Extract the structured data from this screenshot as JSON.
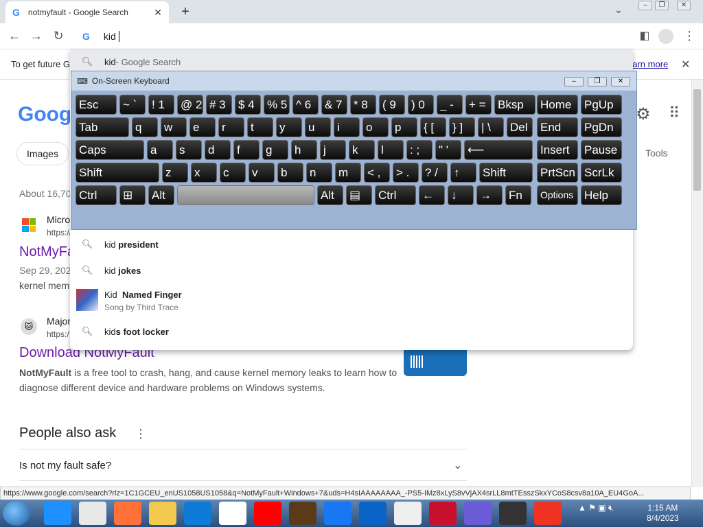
{
  "browser": {
    "tab_title": "notmyfault - Google Search",
    "tab_icon": "G",
    "close_tab": "✕",
    "new_tab": "+",
    "tab_menu": "⌄"
  },
  "toolbar": {
    "back": "←",
    "forward": "→",
    "reload": "↻",
    "omnibox_icon": "G",
    "omnibox_text": "kid",
    "sidepanel": "◧",
    "menu": "⋮"
  },
  "infobar": {
    "text_left": "To get future G",
    "text_right": "earn more",
    "close": "✕"
  },
  "suggestions": {
    "top": {
      "prefix": "kid",
      "suffix": " - Google Search"
    },
    "items": [
      {
        "prefix": "kid ",
        "bold": "president"
      },
      {
        "prefix": "kid ",
        "bold": "jokes"
      },
      {
        "prefix": "Kid ",
        "bold": "Named Finger",
        "subtitle": "Song by Third Trace"
      },
      {
        "prefix": "kid",
        "bold": "s foot locker"
      }
    ]
  },
  "osk": {
    "title": "On-Screen Keyboard",
    "rows": [
      [
        {
          "l": "Esc"
        },
        {
          "l": "~ `"
        },
        {
          "l": "! 1"
        },
        {
          "l": "@ 2"
        },
        {
          "l": "# 3"
        },
        {
          "l": "$ 4"
        },
        {
          "l": "% 5"
        },
        {
          "l": "^ 6"
        },
        {
          "l": "& 7"
        },
        {
          "l": "* 8"
        },
        {
          "l": "( 9"
        },
        {
          "l": ") 0"
        },
        {
          "l": "_ -"
        },
        {
          "l": "+ ="
        },
        {
          "l": "Bksp"
        },
        {
          "l": "Home"
        },
        {
          "l": "PgUp"
        }
      ],
      [
        {
          "l": "Tab"
        },
        {
          "l": "q"
        },
        {
          "l": "w"
        },
        {
          "l": "e"
        },
        {
          "l": "r"
        },
        {
          "l": "t"
        },
        {
          "l": "y"
        },
        {
          "l": "u"
        },
        {
          "l": "i"
        },
        {
          "l": "o"
        },
        {
          "l": "p"
        },
        {
          "l": "{ ["
        },
        {
          "l": "} ]"
        },
        {
          "l": "| \\"
        },
        {
          "l": "Del"
        },
        {
          "l": "End"
        },
        {
          "l": "PgDn"
        }
      ],
      [
        {
          "l": "Caps"
        },
        {
          "l": "a"
        },
        {
          "l": "s"
        },
        {
          "l": "d"
        },
        {
          "l": "f"
        },
        {
          "l": "g"
        },
        {
          "l": "h"
        },
        {
          "l": "j"
        },
        {
          "l": "k"
        },
        {
          "l": "l"
        },
        {
          "l": ": ;"
        },
        {
          "l": "\" '"
        },
        {
          "l": "⟵"
        },
        {
          "l": "Insert"
        },
        {
          "l": "Pause"
        }
      ],
      [
        {
          "l": "Shift"
        },
        {
          "l": "z"
        },
        {
          "l": "x"
        },
        {
          "l": "c"
        },
        {
          "l": "v"
        },
        {
          "l": "b"
        },
        {
          "l": "n"
        },
        {
          "l": "m"
        },
        {
          "l": "< ,"
        },
        {
          "l": "> ."
        },
        {
          "l": "? /"
        },
        {
          "l": "↑"
        },
        {
          "l": "Shift"
        },
        {
          "l": "PrtScn"
        },
        {
          "l": "ScrLk"
        }
      ],
      [
        {
          "l": "Ctrl"
        },
        {
          "l": "⊞"
        },
        {
          "l": "Alt"
        },
        {
          "l": ""
        },
        {
          "l": "Alt"
        },
        {
          "l": "▤"
        },
        {
          "l": "Ctrl"
        },
        {
          "l": "←"
        },
        {
          "l": "↓"
        },
        {
          "l": "→"
        },
        {
          "l": "Fn"
        },
        {
          "l": "Options"
        },
        {
          "l": "Help"
        }
      ]
    ]
  },
  "page": {
    "logo": "Google",
    "chip_images": "Images",
    "tools": "Tools",
    "result_count": "About 16,70",
    "r1": {
      "site": "Micro",
      "url": "https://",
      "title": "NotMyFa",
      "date": "Sep 29, 202",
      "desc": "kernel mem"
    },
    "r2": {
      "site": "Major",
      "url": "https:/",
      "title": "Download NotMyFault",
      "desc_bold": "NotMyFault",
      "desc": " is a free tool to crash, hang, and cause kernel memory leaks to learn how to diagnose different device and hardware problems on Windows systems."
    },
    "paa_title": "People also ask",
    "paa_q1": "Is not my fault safe?"
  },
  "status_url": "https://www.google.com/search?rlz=1C1GCEU_enUS1058US1058&q=NotMyFault+Windows+7&uds=H4sIAAAAAAAA_-PS5-IMz8xLyS8vVjAX4srLL8mtTEsszSkxYCoS8csv8a10A_EU4GoA...",
  "taskbar": {
    "clock_time": "1:15 AM",
    "clock_date": "8/4/2023",
    "apps": [
      "ie",
      "chrome",
      "firefox",
      "explorer",
      "edge",
      "amazon",
      "youtube",
      "ups",
      "facebook",
      "outlook",
      "wikipedia",
      "bank-of-america",
      "copilot",
      "store",
      "sun-app"
    ]
  }
}
